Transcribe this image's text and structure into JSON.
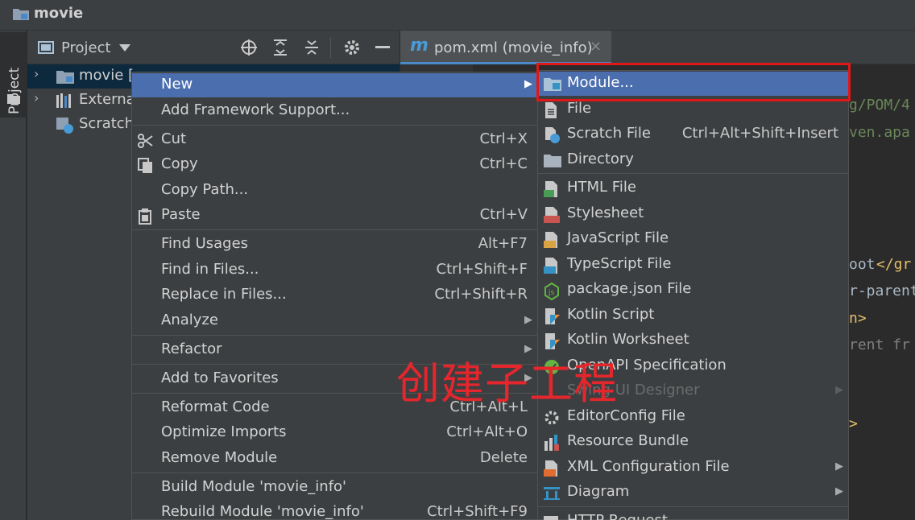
{
  "window": {
    "title": "movie"
  },
  "tool_window": {
    "strip_label": "Project",
    "header_label": "Project"
  },
  "tree": [
    {
      "label": "movie [",
      "selected": true
    },
    {
      "label": "Externa",
      "selected": false
    },
    {
      "label": "Scratch",
      "selected": false
    }
  ],
  "editor_tab": {
    "icon_letter": "m",
    "label": "pom.xml (movie_info)",
    "close": "×"
  },
  "code_fragments": [
    {
      "text": "g/POM/4",
      "color": "#6a8759"
    },
    {
      "text": "ven.apa",
      "color": "#6a8759"
    },
    {
      "text": "oot",
      "color": "#a9b7c6"
    },
    {
      "text": "</gr",
      "color": "#e8bf6a"
    },
    {
      "text": "r-parent",
      "color": "#a9b7c6"
    },
    {
      "text": "n>",
      "color": "#e8bf6a"
    },
    {
      "text": "rent fr",
      "color": "#808080"
    },
    {
      "text": ">",
      "color": "#e8bf6a"
    }
  ],
  "context_menu": {
    "items": [
      {
        "label": "New",
        "shortcut": "",
        "submenu": true,
        "highlighted": true,
        "icon": ""
      },
      {
        "label": "Add Framework Support...",
        "shortcut": "",
        "submenu": false,
        "icon": ""
      },
      {
        "label": "Cut",
        "shortcut": "Ctrl+X",
        "submenu": false,
        "icon": "scissors-icon"
      },
      {
        "label": "Copy",
        "shortcut": "Ctrl+C",
        "submenu": false,
        "icon": "copy-icon"
      },
      {
        "label": "Copy Path...",
        "shortcut": "",
        "submenu": false,
        "icon": ""
      },
      {
        "label": "Paste",
        "shortcut": "Ctrl+V",
        "submenu": false,
        "icon": "clipboard-icon"
      },
      {
        "label": "Find Usages",
        "shortcut": "Alt+F7",
        "submenu": false,
        "icon": ""
      },
      {
        "label": "Find in Files...",
        "shortcut": "Ctrl+Shift+F",
        "submenu": false,
        "icon": ""
      },
      {
        "label": "Replace in Files...",
        "shortcut": "Ctrl+Shift+R",
        "submenu": false,
        "icon": ""
      },
      {
        "label": "Analyze",
        "shortcut": "",
        "submenu": true,
        "icon": ""
      },
      {
        "label": "Refactor",
        "shortcut": "",
        "submenu": true,
        "icon": ""
      },
      {
        "label": "Add to Favorites",
        "shortcut": "",
        "submenu": true,
        "icon": ""
      },
      {
        "label": "Reformat Code",
        "shortcut": "Ctrl+Alt+L",
        "submenu": false,
        "icon": ""
      },
      {
        "label": "Optimize Imports",
        "shortcut": "Ctrl+Alt+O",
        "submenu": false,
        "icon": ""
      },
      {
        "label": "Remove Module",
        "shortcut": "Delete",
        "submenu": false,
        "icon": ""
      },
      {
        "label": "Build Module 'movie_info'",
        "shortcut": "",
        "submenu": false,
        "icon": ""
      },
      {
        "label": "Rebuild Module 'movie_info'",
        "shortcut": "Ctrl+Shift+F9",
        "submenu": false,
        "icon": ""
      }
    ]
  },
  "new_submenu": {
    "items": [
      {
        "label": "Module...",
        "shortcut": "",
        "submenu": false,
        "highlighted": true,
        "icon": "module-folder-icon"
      },
      {
        "label": "File",
        "shortcut": "",
        "submenu": false,
        "icon": "file-icon"
      },
      {
        "label": "Scratch File",
        "shortcut": "Ctrl+Alt+Shift+Insert",
        "submenu": false,
        "icon": "scratch-file-icon"
      },
      {
        "label": "Directory",
        "shortcut": "",
        "submenu": false,
        "icon": "folder-icon"
      },
      {
        "label": "HTML File",
        "shortcut": "",
        "submenu": false,
        "icon": "html-file-icon"
      },
      {
        "label": "Stylesheet",
        "shortcut": "",
        "submenu": false,
        "icon": "css-file-icon"
      },
      {
        "label": "JavaScript File",
        "shortcut": "",
        "submenu": false,
        "icon": "js-file-icon"
      },
      {
        "label": "TypeScript File",
        "shortcut": "",
        "submenu": false,
        "icon": "ts-file-icon"
      },
      {
        "label": "package.json File",
        "shortcut": "",
        "submenu": false,
        "icon": "nodejs-icon"
      },
      {
        "label": "Kotlin Script",
        "shortcut": "",
        "submenu": false,
        "icon": "kotlin-icon"
      },
      {
        "label": "Kotlin Worksheet",
        "shortcut": "",
        "submenu": false,
        "icon": "kotlin-icon"
      },
      {
        "label": "OpenAPI Specification",
        "shortcut": "",
        "submenu": false,
        "icon": "openapi-icon"
      },
      {
        "label": "Swing UI Designer",
        "shortcut": "",
        "submenu": true,
        "disabled": true,
        "icon": ""
      },
      {
        "label": "EditorConfig File",
        "shortcut": "",
        "submenu": false,
        "icon": "gear-icon"
      },
      {
        "label": "Resource Bundle",
        "shortcut": "",
        "submenu": false,
        "icon": "resource-bundle-icon"
      },
      {
        "label": "XML Configuration File",
        "shortcut": "",
        "submenu": true,
        "icon": "xml-file-icon"
      },
      {
        "label": "Diagram",
        "shortcut": "",
        "submenu": true,
        "icon": "diagram-icon"
      },
      {
        "label": "HTTP Request",
        "shortcut": "",
        "submenu": false,
        "icon": "http-icon"
      }
    ]
  },
  "annotation": {
    "text": "创建子工程",
    "color": "#e5262c"
  }
}
